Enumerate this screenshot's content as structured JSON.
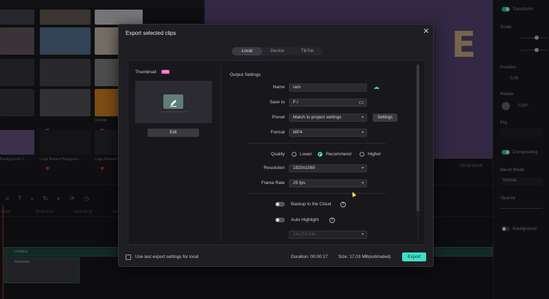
{
  "background": {
    "media_items": [
      {
        "label": "",
        "color": "#3a3a42"
      },
      {
        "label": "",
        "color": "#5a5a60"
      },
      {
        "label": "",
        "color": "#2f2f36"
      },
      {
        "label": "Orange",
        "color": "#e08a25"
      },
      {
        "label": "Background V...",
        "color": "#6e5a8a"
      },
      {
        "label": "Logo Reveal Backgrou...",
        "color": "#2a2a30"
      },
      {
        "label": "Logo Reveal Backgrou...",
        "color": "#2a2a33"
      }
    ],
    "preview_text": "E",
    "time_current": "/",
    "time_total": "/ 00:00:00:00",
    "right_panel": {
      "transform_label": "Transform",
      "scale_label": "Scale",
      "position_label": "Position",
      "position_x": "0.00",
      "rotate_label": "Rotate",
      "rotate_value": "0.00°",
      "flip_label": "Flip",
      "compositing_label": "Compositing",
      "blend_mode_label": "Blend Mode",
      "blend_mode_value": "Normal",
      "opacity_label": "Opacity",
      "background_label": "Background"
    },
    "timeline": {
      "ruler": [
        "00:00",
        "00:00:00:10",
        "00:00:00:15",
        "00:00:00:20"
      ],
      "track_teal_label": "Untitled",
      "track_video_label": "fireworks"
    }
  },
  "dialog": {
    "title": "Export selected clips",
    "tabs": [
      {
        "label": "Local",
        "active": true
      },
      {
        "label": "Device",
        "active": false
      },
      {
        "label": "TikTok",
        "active": false
      }
    ],
    "thumbnail_label": "Thumbnail:",
    "new_badge": "NEW",
    "edit_button": "Edit",
    "output_settings_label": "Output Settings",
    "fields": {
      "name_label": "Name",
      "name_value": "ram",
      "save_to_label": "Save to",
      "save_to_value": "F:/",
      "preset_label": "Preset",
      "preset_value": "Match to project settings",
      "settings_button": "Settings",
      "format_label": "Format",
      "format_value": "MP4",
      "quality_label": "Quality",
      "quality_options": [
        "Lower",
        "Recommend",
        "Higher"
      ],
      "quality_selected": "Recommend",
      "resolution_label": "Resolution",
      "resolution_value": "1920x1080",
      "frame_rate_label": "Frame Rate",
      "frame_rate_value": "25 fps",
      "backup_label": "Backup to the Cloud",
      "auto_highlight_label": "Auto Highlight",
      "auto_highlight_value": "15s(TikTok)"
    },
    "footer": {
      "remember_label": "Use last export settings for local",
      "duration_text": "Duration: 00:00:17",
      "size_text": "Size: 17.03 MB(estimated)",
      "export_button": "Export"
    }
  }
}
